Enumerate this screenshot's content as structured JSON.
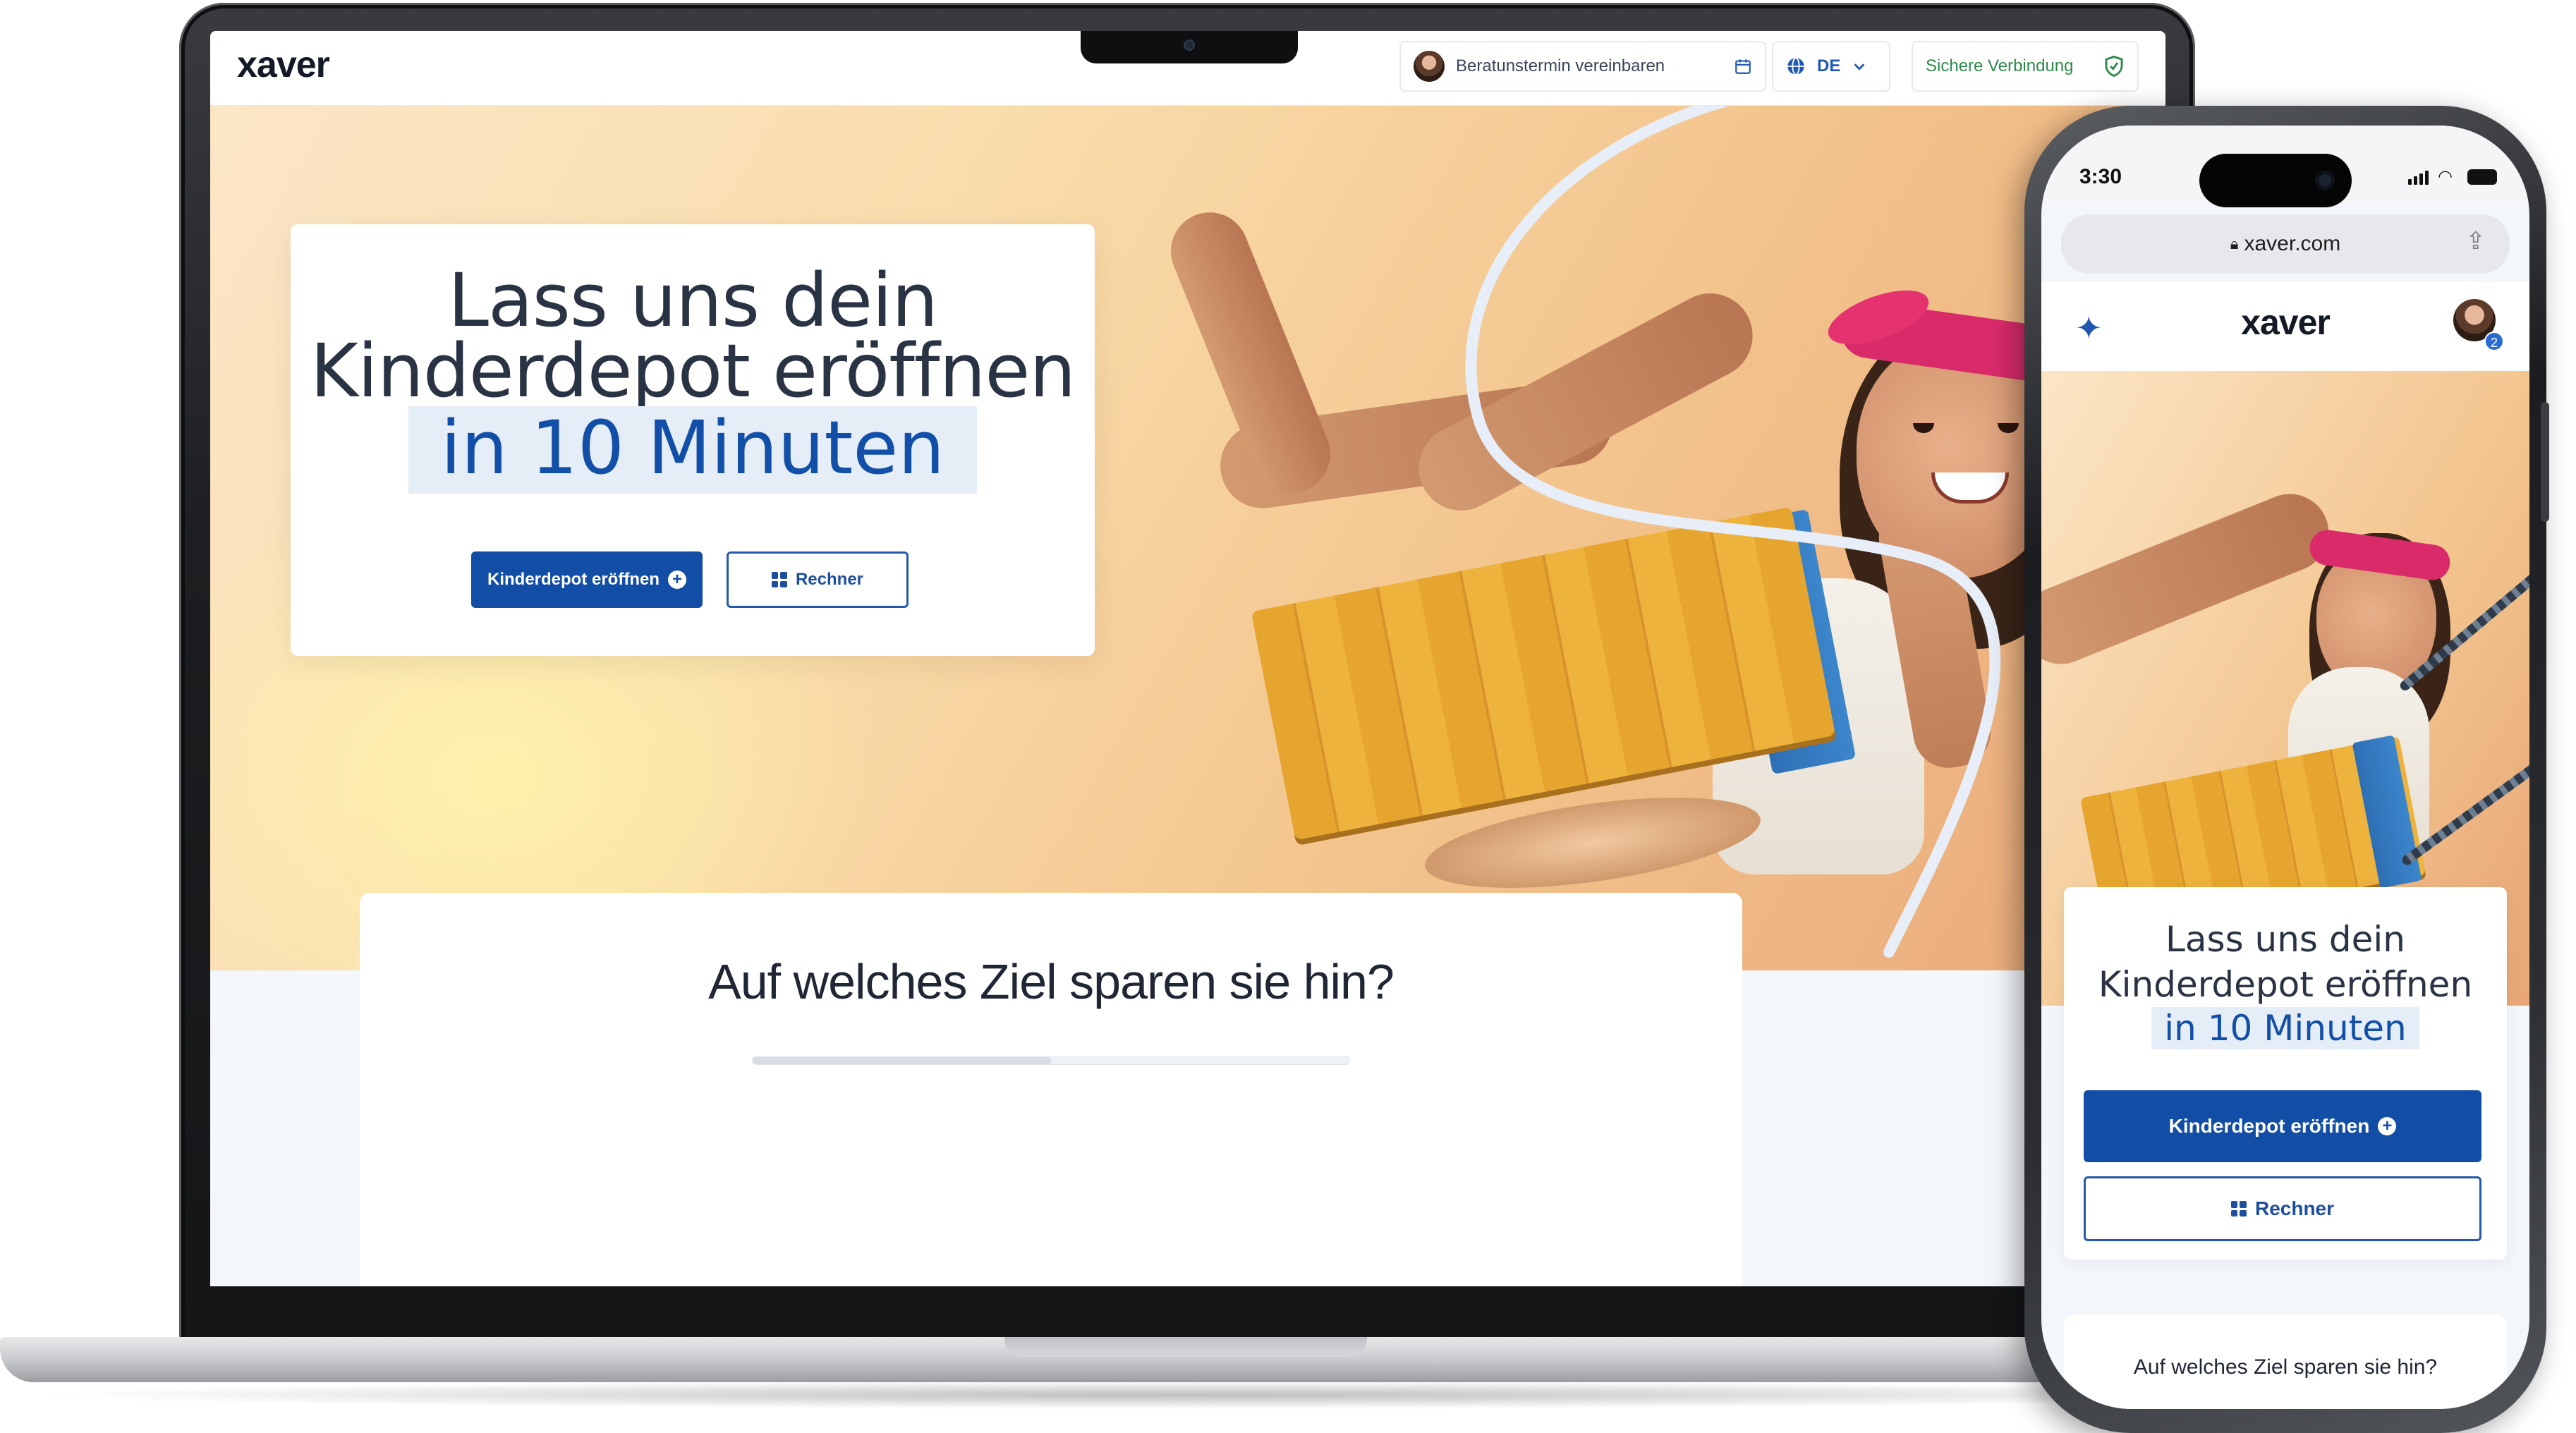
{
  "laptop": {
    "header": {
      "logo": "xaver",
      "appointment_label": "Beratunstermin vereinbaren",
      "language": "DE",
      "secure_label": "Sichere Verbindung"
    },
    "hero": {
      "title_line1": "Lass uns dein",
      "title_line2": "Kinderdepot eröffnen",
      "title_highlight": "in 10 Minuten",
      "primary_button": "Kinderdepot eröffnen",
      "secondary_button": "Rechner"
    },
    "section": {
      "title": "Auf welches Ziel sparen sie hin?",
      "progress": 0.5
    }
  },
  "phone": {
    "status": {
      "time": "3:30"
    },
    "browser": {
      "url": "xaver.com"
    },
    "header": {
      "logo": "xaver",
      "badge": "2"
    },
    "hero": {
      "title_line1": "Lass uns dein",
      "title_line2": "Kinderdepot eröffnen",
      "title_highlight": "in 10 Minuten",
      "primary_button": "Kinderdepot eröffnen",
      "secondary_button": "Rechner"
    },
    "section": {
      "title": "Auf welches Ziel sparen sie hin?"
    }
  },
  "colors": {
    "brand_blue": "#124ea6",
    "highlight_bg": "#e5edf6",
    "secure_green": "#2f8a4c",
    "headband_pink": "#d92b6a",
    "swing_wood": "#e6a52e"
  },
  "icons": {
    "appointment": "calendar-icon",
    "language": "globe-icon",
    "language_toggle": "chevron-down-icon",
    "secure": "shield-check-icon",
    "primary_button": "plus-circle-icon",
    "secondary_button": "grid-icon",
    "phone_sparkle": "sparkle-icon",
    "phone_lock": "lock-icon",
    "phone_share": "share-icon"
  }
}
